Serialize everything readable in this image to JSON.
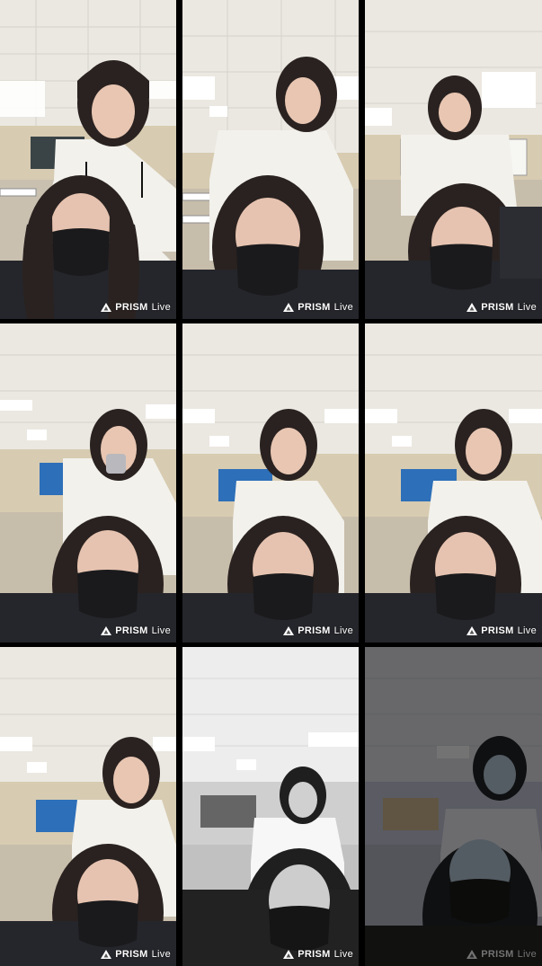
{
  "watermark": {
    "brand": "PRISM",
    "suffix": "Live"
  },
  "tiles": [
    {
      "id": 1,
      "filter": "normal"
    },
    {
      "id": 2,
      "filter": "normal"
    },
    {
      "id": 3,
      "filter": "normal"
    },
    {
      "id": 4,
      "filter": "normal"
    },
    {
      "id": 5,
      "filter": "normal"
    },
    {
      "id": 6,
      "filter": "normal"
    },
    {
      "id": 7,
      "filter": "normal"
    },
    {
      "id": 8,
      "filter": "grayscale"
    },
    {
      "id": 9,
      "filter": "dark-blue"
    }
  ],
  "colors": {
    "ceiling": "#e9e6df",
    "wall": "#d8cdb4",
    "screen": "#2d6fb8",
    "jacket_white": "#f1f0ea",
    "hair": "#2a2220",
    "mask": "#1a1a1c",
    "sweater": "#25262b",
    "skin": "#e6c3b0"
  }
}
